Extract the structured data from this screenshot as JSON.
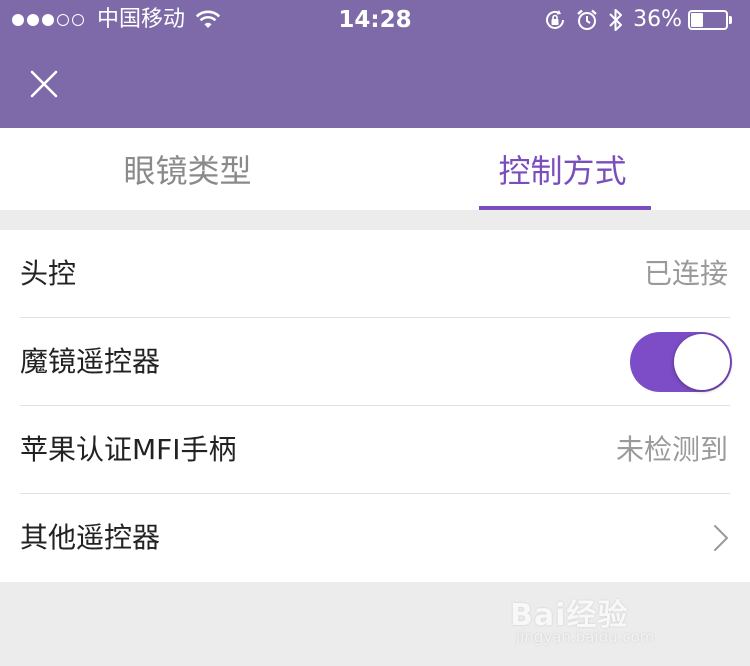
{
  "status_bar": {
    "carrier": "中国移动",
    "time": "14:28",
    "battery_percent": "36%",
    "battery_level": 0.36,
    "signal_bars_filled": 3,
    "signal_bars_total": 5
  },
  "nav": {
    "close_icon": "close-icon"
  },
  "tabs": [
    {
      "label": "眼镜类型",
      "active": false
    },
    {
      "label": "控制方式",
      "active": true
    }
  ],
  "controls": [
    {
      "label": "头控",
      "value": "已连接"
    },
    {
      "label": "魔镜遥控器",
      "toggle_on": true
    },
    {
      "label": "苹果认证MFI手柄",
      "value": "未检测到"
    },
    {
      "label": "其他遥控器",
      "icon": "chevron-right-icon"
    }
  ],
  "watermark": {
    "main": "Bai经验",
    "sub": "jingyan.baidu.com"
  },
  "colors": {
    "header_bg": "#7e6aa8",
    "accent": "#7a4fbd",
    "toggle_on": "#7d4cc7"
  }
}
